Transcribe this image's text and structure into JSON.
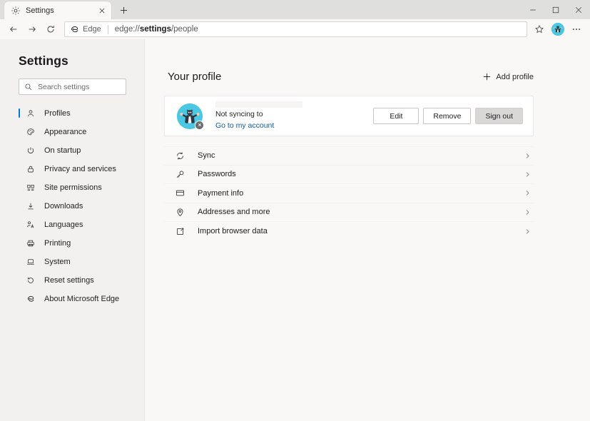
{
  "window": {
    "controls": [
      {
        "name": "minimize-button",
        "glyph": "minimize"
      },
      {
        "name": "maximize-button",
        "glyph": "maximize"
      },
      {
        "name": "close-button",
        "glyph": "close"
      }
    ]
  },
  "tabbar": {
    "tab": {
      "title": "Settings",
      "favicon": "gear-icon",
      "close": "close-icon"
    },
    "new_tab_label": "+"
  },
  "toolbar": {
    "back": "back-arrow-icon",
    "forward": "forward-arrow-icon",
    "reload": "reload-icon",
    "brand_label": "Edge",
    "url_prefix": "edge://",
    "url_bold": "settings",
    "url_suffix": "/people",
    "favorites": "star-icon",
    "profile": "profile-avatar-icon",
    "more": "ellipsis-icon"
  },
  "sidebar": {
    "title": "Settings",
    "search": {
      "placeholder": "Search settings",
      "value": ""
    },
    "items": [
      {
        "label": "Profiles",
        "icon": "person-icon",
        "active": true
      },
      {
        "label": "Appearance",
        "icon": "palette-icon",
        "active": false
      },
      {
        "label": "On startup",
        "icon": "power-icon",
        "active": false
      },
      {
        "label": "Privacy and services",
        "icon": "lock-icon",
        "active": false
      },
      {
        "label": "Site permissions",
        "icon": "permissions-icon",
        "active": false
      },
      {
        "label": "Downloads",
        "icon": "download-icon",
        "active": false
      },
      {
        "label": "Languages",
        "icon": "languages-icon",
        "active": false
      },
      {
        "label": "Printing",
        "icon": "printer-icon",
        "active": false
      },
      {
        "label": "System",
        "icon": "laptop-icon",
        "active": false
      },
      {
        "label": "Reset settings",
        "icon": "reset-icon",
        "active": false
      },
      {
        "label": "About Microsoft Edge",
        "icon": "edge-icon",
        "active": false
      }
    ]
  },
  "main": {
    "section_title": "Your profile",
    "add_profile_label": "Add profile",
    "profile_card": {
      "account_name": "",
      "sync_status": "Not syncing to",
      "account_link": "Go to my account",
      "avatar": "ninja-cat-avatar",
      "avatar_badge": "error-badge-icon",
      "buttons": [
        {
          "label": "Edit",
          "name": "edit-profile-button",
          "shaded": false
        },
        {
          "label": "Remove",
          "name": "remove-profile-button",
          "shaded": false
        },
        {
          "label": "Sign out",
          "name": "sign-out-button",
          "shaded": true
        }
      ]
    },
    "rows": [
      {
        "label": "Sync",
        "icon": "sync-icon"
      },
      {
        "label": "Passwords",
        "icon": "key-icon"
      },
      {
        "label": "Payment info",
        "icon": "card-icon"
      },
      {
        "label": "Addresses and more",
        "icon": "location-pin-icon"
      },
      {
        "label": "Import browser data",
        "icon": "import-icon"
      }
    ]
  },
  "colors": {
    "accent": "#0078d4",
    "link": "#0a5ca8",
    "avatar_bg": "#4ac7e3",
    "sidebar_bg": "#f2f1f0",
    "main_bg": "#f9f8f7",
    "titlebar_bg": "#dfdfde"
  }
}
